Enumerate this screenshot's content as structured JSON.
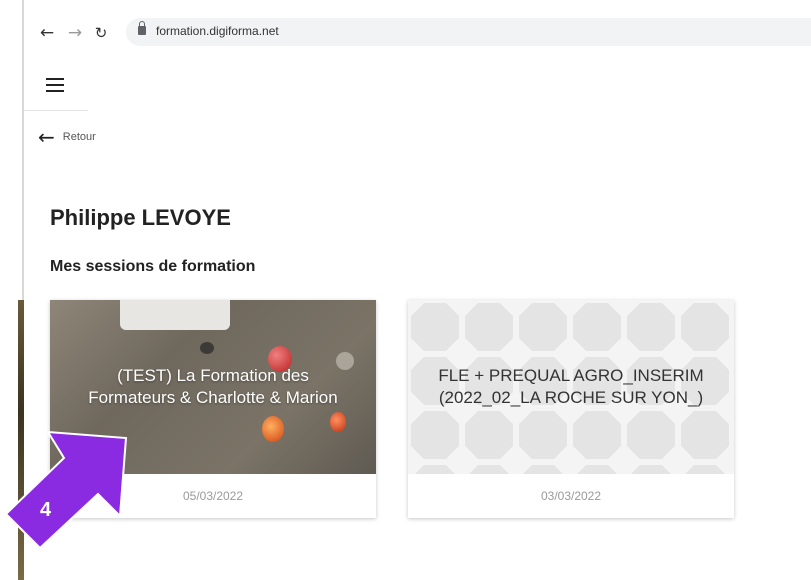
{
  "browser": {
    "url": "formation.digiforma.net",
    "back_icon": "arrow-left-icon",
    "forward_icon": "arrow-right-icon",
    "reload_icon": "reload-icon"
  },
  "header": {
    "menu_icon": "hamburger-menu-icon"
  },
  "nav": {
    "back_label": "Retour"
  },
  "user": {
    "name": "Philippe LEVOYE"
  },
  "sessions": {
    "heading": "Mes sessions de formation",
    "items": [
      {
        "title": "(TEST) La Formation des\nFormateurs & Charlotte & Marion",
        "date": "05/03/2022"
      },
      {
        "title": "FLE + PREQUAL AGRO_INSERIM\n(2022_02_LA ROCHE SUR YON_)",
        "date": "03/03/2022"
      }
    ]
  },
  "annotation": {
    "label": "4",
    "color": "#8a2be2"
  },
  "colors": {
    "accent": "#8a2be2",
    "date_text": "#9a9a9a"
  }
}
